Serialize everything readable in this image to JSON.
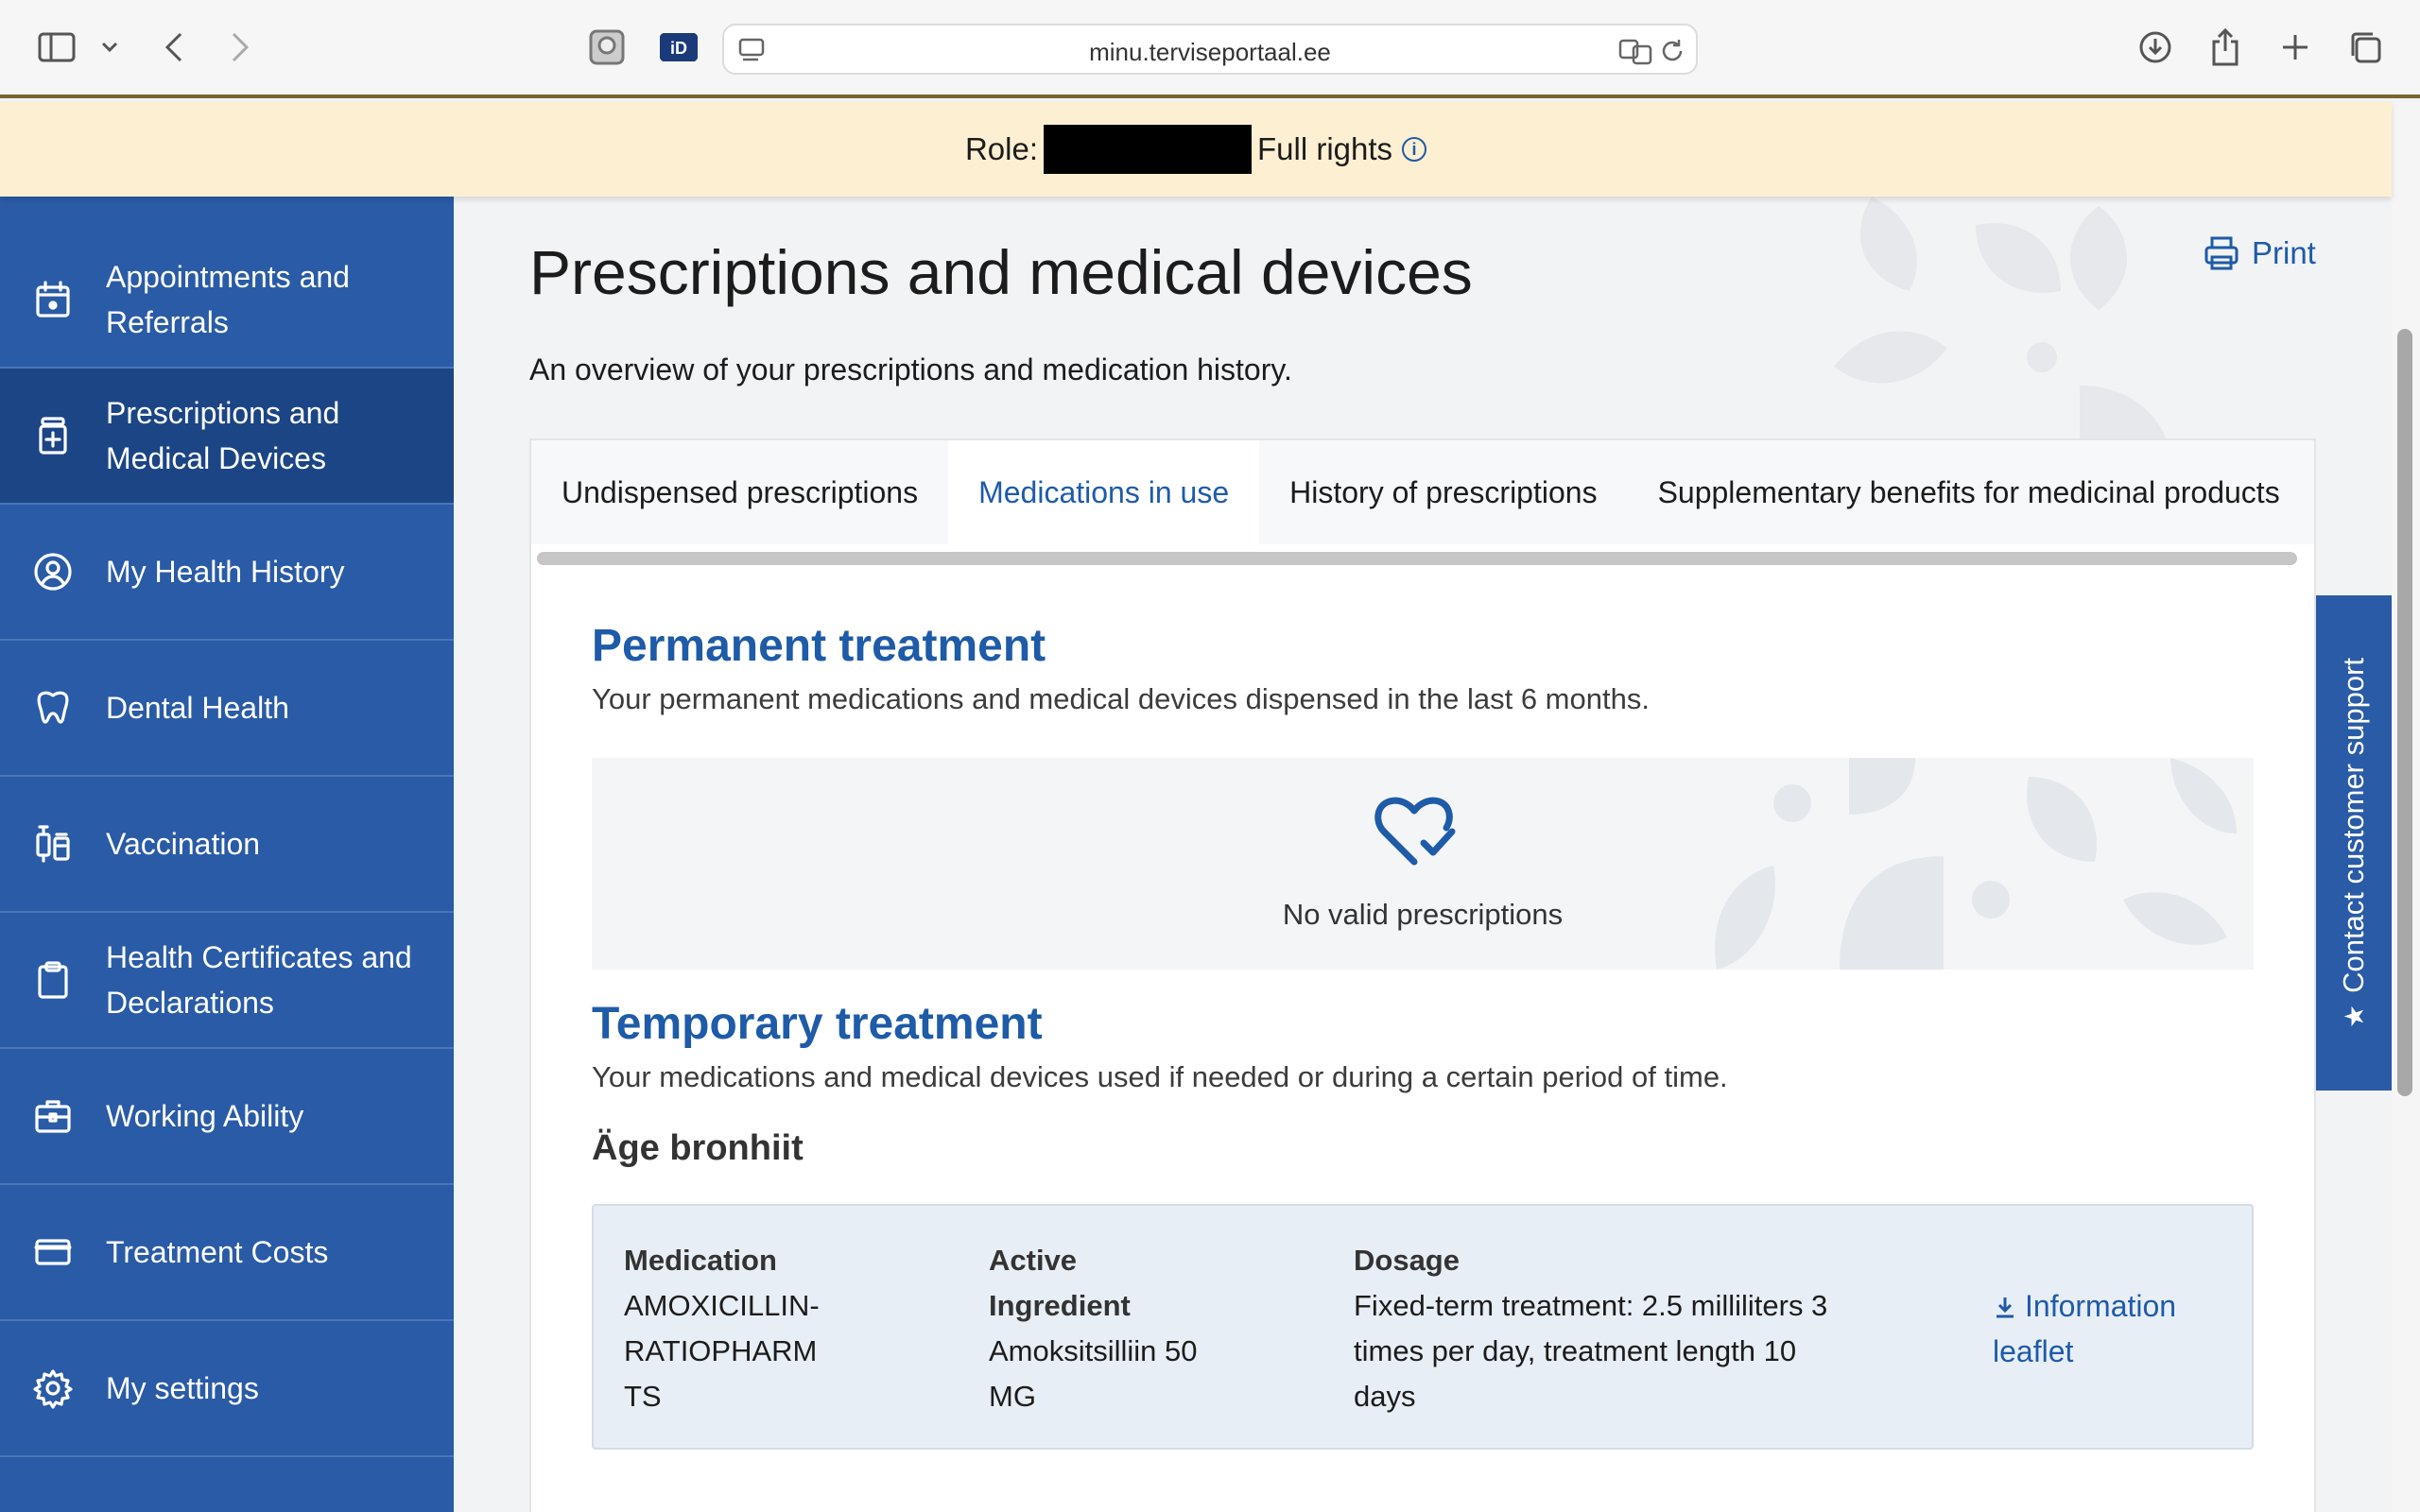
{
  "browser": {
    "url": "minu.terviseportaal.ee"
  },
  "role_banner": {
    "role_label": "Role:",
    "rights": "Full rights"
  },
  "sidebar": {
    "items": [
      {
        "label": "Appointments and Referrals",
        "icon": "calendar-icon",
        "active": false
      },
      {
        "label": "Prescriptions and Medical Devices",
        "icon": "pill-bottle-icon",
        "active": true
      },
      {
        "label": "My Health History",
        "icon": "user-circle-icon",
        "active": false
      },
      {
        "label": "Dental Health",
        "icon": "tooth-icon",
        "active": false
      },
      {
        "label": "Vaccination",
        "icon": "syringe-icon",
        "active": false
      },
      {
        "label": "Health Certificates and Declarations",
        "icon": "clipboard-icon",
        "active": false
      },
      {
        "label": "Working Ability",
        "icon": "briefcase-icon",
        "active": false
      },
      {
        "label": "Treatment Costs",
        "icon": "card-icon",
        "active": false
      },
      {
        "label": "My settings",
        "icon": "gear-icon",
        "active": false
      }
    ]
  },
  "main": {
    "title": "Prescriptions and medical devices",
    "print_label": "Print",
    "subtitle": "An overview of your prescriptions and medication history.",
    "tabs": [
      {
        "label": "Undispensed prescriptions",
        "active": false
      },
      {
        "label": "Medications in use",
        "active": true
      },
      {
        "label": "History of prescriptions",
        "active": false
      },
      {
        "label": "Supplementary benefits for medicinal products",
        "active": false
      }
    ],
    "permanent": {
      "title": "Permanent treatment",
      "description": "Your permanent medications and medical devices dispensed in the last 6 months.",
      "empty_text": "No valid prescriptions"
    },
    "temporary": {
      "title": "Temporary treatment",
      "description": "Your medications and medical devices used if needed or during a certain period of time.",
      "group_title": "Äge bronhiit",
      "medication": {
        "medication_header": "Medication",
        "medication_lines": [
          "AMOXICILLIN-",
          "RATIOPHARM",
          "TS"
        ],
        "ingredient_header_lines": [
          "Active",
          "Ingredient"
        ],
        "ingredient_lines": [
          "Amoksitsilliin 50",
          "MG"
        ],
        "dosage_header": "Dosage",
        "dosage_lines": [
          "Fixed-term treatment: 2.5 milliliters 3",
          "times per day, treatment length 10",
          "days"
        ],
        "leaflet_lines": [
          "Information",
          "leaflet"
        ]
      }
    }
  },
  "support": {
    "label": "Contact customer support"
  },
  "colors": {
    "primary": "#2a5ba6",
    "active_nav": "#1b4585",
    "link": "#1e5ba8",
    "banner": "#fdf0d2"
  }
}
